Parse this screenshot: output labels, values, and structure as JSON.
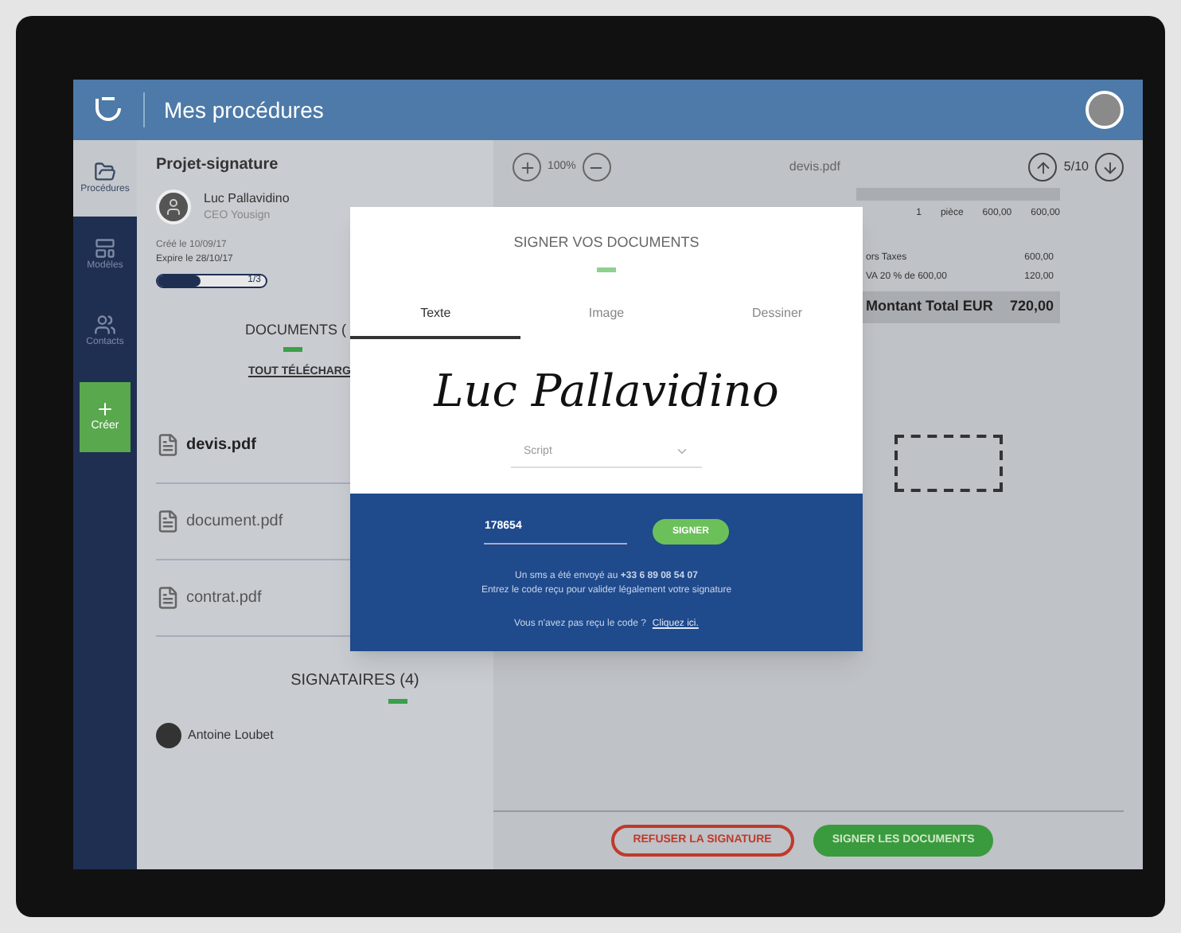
{
  "topbar": {
    "title": "Mes procédures"
  },
  "rail": [
    {
      "label": "Procédures",
      "kind": "item",
      "selected": true
    },
    {
      "label": "Modèles",
      "kind": "item",
      "selected": false
    },
    {
      "label": "Contacts",
      "kind": "item",
      "selected": false
    },
    {
      "label": "Créer",
      "kind": "create",
      "selected": false
    }
  ],
  "project": {
    "title": "Projet-signature",
    "owner": "Luc Pallavidino",
    "role": "CEO Yousign",
    "created": "Créé le 10/09/17",
    "expires": "Expire le 28/10/17",
    "progress": {
      "level": 0.4,
      "reading": "1/3"
    }
  },
  "documents": {
    "heading": "DOCUMENTS (",
    "download": "TOUT TÉLÉCHARG",
    "files": [
      {
        "name": "devis.pdf",
        "selected": true
      },
      {
        "name": "document.pdf",
        "selected": false
      },
      {
        "name": "contrat.pdf",
        "selected": false
      }
    ]
  },
  "signers": {
    "heading": "SIGNATAIRES (4)",
    "people": [
      "Antoine Loubet"
    ]
  },
  "viewer": {
    "zoom": "100%",
    "file": "devis.pdf",
    "page": "5/10"
  },
  "invoice": {
    "row": [
      "1",
      "pièce",
      "600,00",
      "600,00"
    ],
    "totals": [
      {
        "label": "ors Taxes",
        "value": "600,00",
        "kind": "plain"
      },
      {
        "label": "VA 20 % de 600,00",
        "value": "120,00",
        "kind": "plain"
      },
      {
        "label": "Montant Total EUR",
        "value": "720,00",
        "kind": "grand"
      }
    ]
  },
  "actions": [
    {
      "label": "REFUSER LA SIGNATURE",
      "kind": "refuse"
    },
    {
      "label": "SIGNER LES DOCUMENTS",
      "kind": "sign"
    }
  ],
  "modal": {
    "title": "SIGNER VOS DOCUMENTS",
    "tabs": [
      {
        "label": "Texte",
        "selected": true
      },
      {
        "label": "Image",
        "selected": false
      },
      {
        "label": "Dessiner",
        "selected": false
      }
    ],
    "signature": "Luc Pallavidino",
    "font_select": "Script",
    "code": "178654",
    "submit": "SIGNER",
    "sms": "Un sms a été envoyé au **+33 6 89 08 54 07**",
    "instruction": "Entrez le code reçu pour valider légalement votre signature",
    "resend": "Vous n'avez pas reçu le code ?",
    "resend_link": "Cliquez ici."
  }
}
